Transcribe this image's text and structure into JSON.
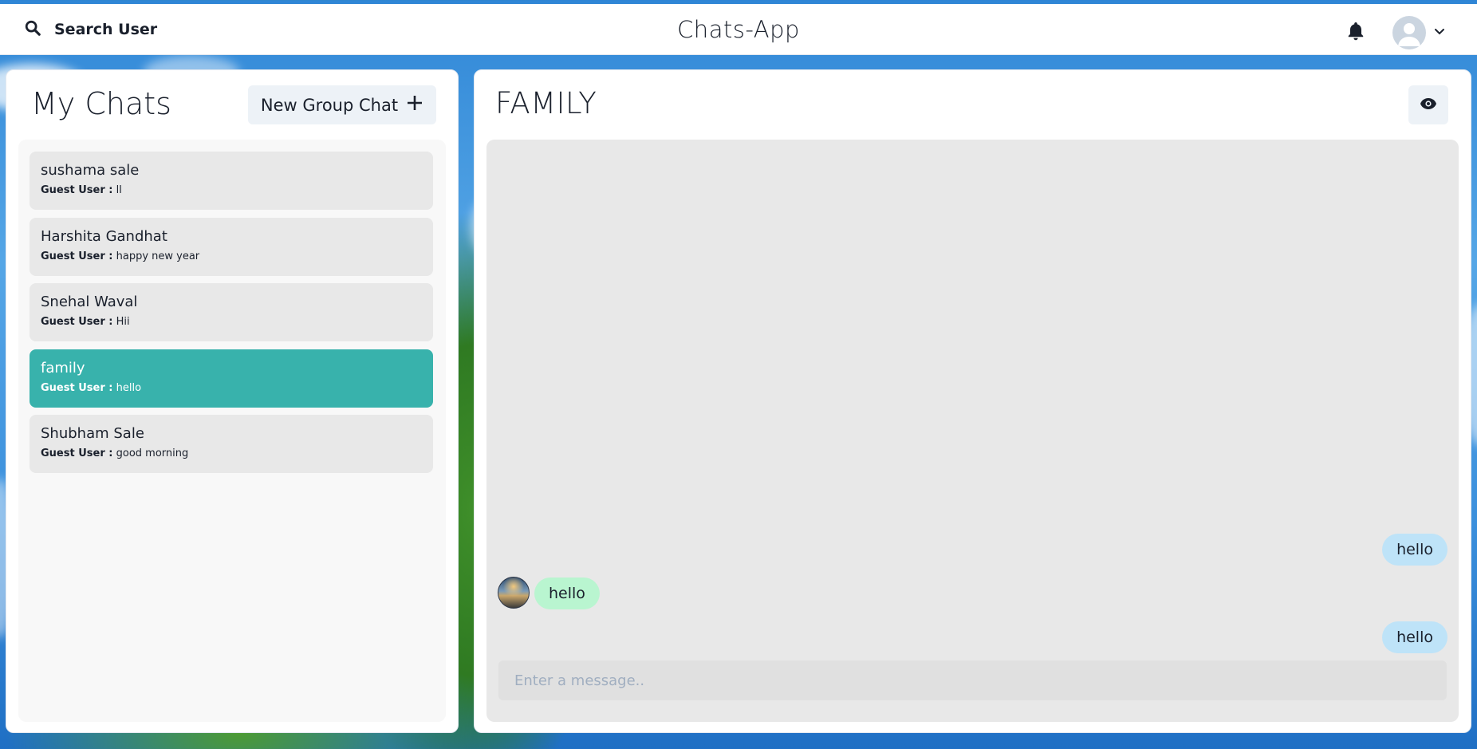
{
  "header": {
    "search_label": "Search User",
    "search_icon": "magnifier",
    "app_title": "Chats-App",
    "notification_icon": "bell",
    "profile_icon": "user-avatar",
    "profile_caret_icon": "chevron-down"
  },
  "sidebar": {
    "title": "My Chats",
    "new_group_label": "New Group Chat",
    "new_group_icon": "plus",
    "chats": [
      {
        "name": "sushama sale",
        "sender": "Guest User :",
        "message": "ll",
        "active": false
      },
      {
        "name": "Harshita Gandhat",
        "sender": "Guest User :",
        "message": "happy new year",
        "active": false
      },
      {
        "name": "Snehal Waval",
        "sender": "Guest User :",
        "message": "Hii",
        "active": false
      },
      {
        "name": "family",
        "sender": "Guest User :",
        "message": "hello",
        "active": true
      },
      {
        "name": "Shubham Sale",
        "sender": "Guest User :",
        "message": "good morning",
        "active": false
      }
    ]
  },
  "chat": {
    "title": "FAMILY",
    "view_icon": "eye",
    "messages": [
      {
        "text": "hello",
        "from": "me"
      },
      {
        "text": "hello",
        "from": "other"
      },
      {
        "text": "hello",
        "from": "me"
      }
    ],
    "input_placeholder": "Enter a message.."
  },
  "colors": {
    "active_chat": "#38b2ac",
    "my_bubble": "#bee3f8",
    "their_bubble": "#b9f5d0",
    "panel_bg": "#ffffff",
    "messages_bg": "#e8e8e8"
  }
}
